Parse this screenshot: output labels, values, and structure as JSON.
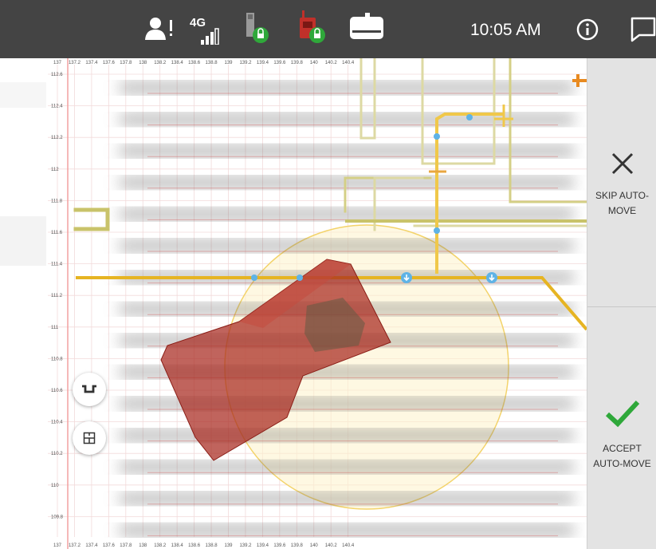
{
  "status_bar": {
    "time": "10:05 AM",
    "network_label": "4G",
    "icons": [
      "user-alert-icon",
      "cellular-signal-icon",
      "tower-locked-icon",
      "radio-device-locked-icon",
      "keyboard-device-icon",
      "info-icon",
      "message-icon"
    ],
    "background": "#444444"
  },
  "grid": {
    "x_ticks": [
      "137",
      "137.2",
      "137.4",
      "137.6",
      "137.8",
      "138",
      "138.2",
      "138.4",
      "138.6",
      "138.8",
      "139",
      "139.2",
      "139.4",
      "139.6",
      "139.8",
      "140",
      "140.2",
      "140.4"
    ],
    "y_ticks": [
      "112.6",
      "112.4",
      "112.2",
      "112",
      "111.8",
      "111.6",
      "111.4",
      "111.2",
      "111",
      "110.8",
      "110.6",
      "110.4",
      "110.2",
      "110",
      "109.8"
    ]
  },
  "map_tools": [
    {
      "name": "route-icon"
    },
    {
      "name": "floor-plan-icon"
    }
  ],
  "actions": {
    "skip_label": "SKIP AUTO-MOVE",
    "accept_label": "ACCEPT AUTO-MOVE",
    "skip_color": "#333333",
    "accept_color": "#2fa83a"
  },
  "colors": {
    "route": "#e6b422",
    "track": "#c9c36a",
    "waypoint": "#5fb3e6",
    "object": "#a8281f",
    "radius": "#f3d36a"
  }
}
